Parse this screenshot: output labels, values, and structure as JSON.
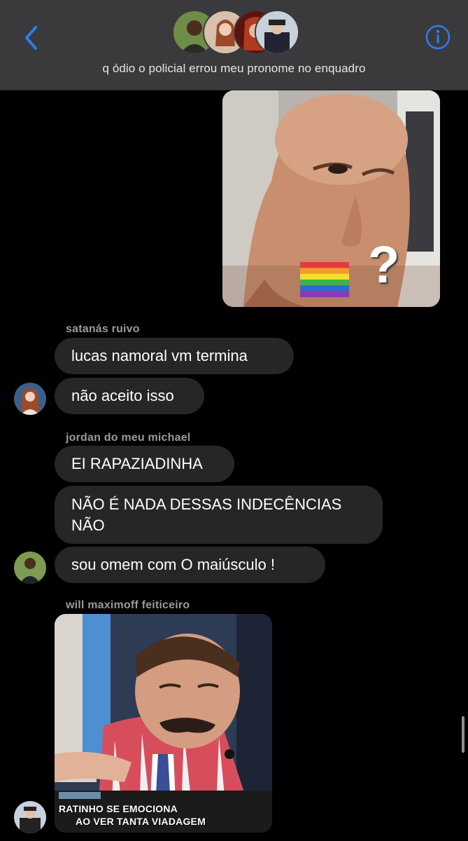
{
  "header": {
    "title": "q ódio o policial errou meu pronome no enquadro",
    "back_icon": "chevron-left-icon",
    "info_icon": "info-circle-icon",
    "accent_color": "#2f7bf6",
    "participants": [
      "participant-1",
      "participant-2",
      "participant-3",
      "participant-4"
    ]
  },
  "messages": [
    {
      "type": "image",
      "direction": "outgoing",
      "content": "meme-face-with-rainbow-flag-and-question-mark",
      "overlay": "?"
    },
    {
      "sender": "satanás ruivo",
      "text": "lucas namoral vm termina"
    },
    {
      "sender": "satanás ruivo",
      "text": "não aceito isso"
    },
    {
      "sender": "jordan do meu michael",
      "text": "EI RAPAZIADINHA"
    },
    {
      "sender": "jordan do meu michael",
      "text": "NÃO É NADA DESSAS INDECÊNCIAS NÃO"
    },
    {
      "sender": "jordan do meu michael",
      "text": "sou omem com O maiúsculo !"
    },
    {
      "sender": "will maximoff feiticeiro",
      "type": "image",
      "content": "tv-host-crying-screenshot",
      "caption_line1": "RATINHO SE EMOCIONA",
      "caption_line2": "AO VER TANTA VIADAGEM"
    }
  ],
  "colors": {
    "background": "#000000",
    "header": "#3a3a3c",
    "bubble": "#262628"
  }
}
